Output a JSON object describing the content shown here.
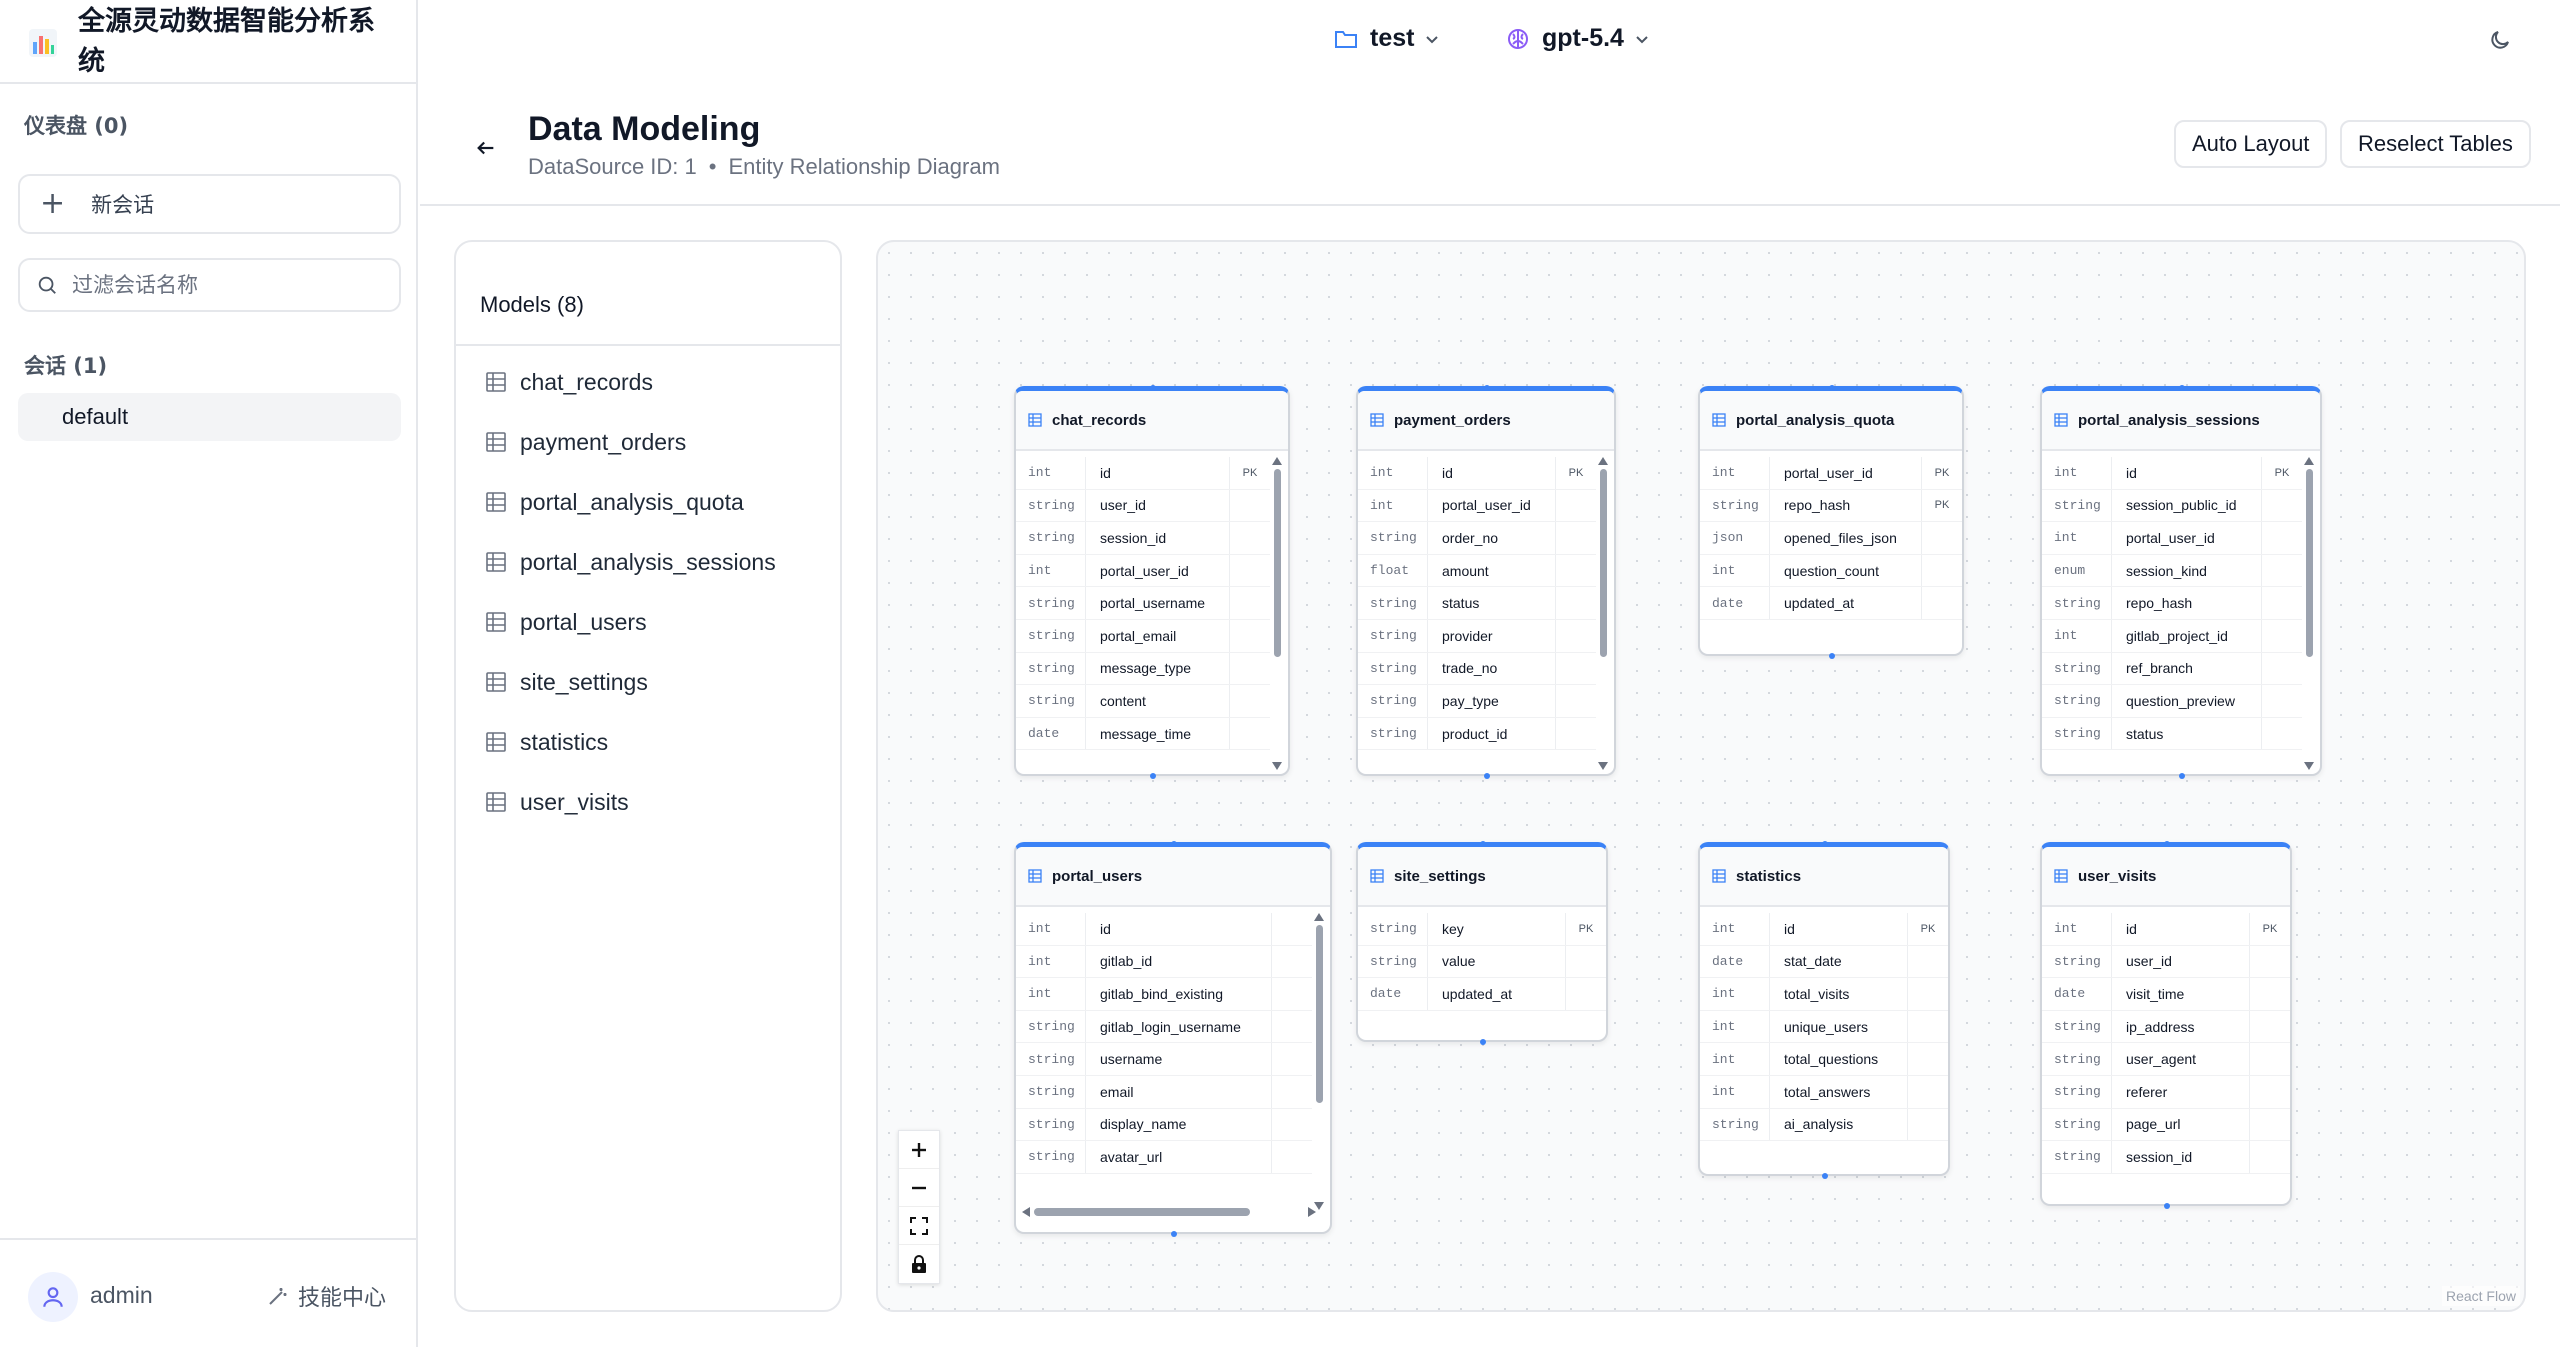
{
  "sidebar": {
    "brand": {
      "title": "全源灵动数据智能分析系统",
      "logo_icon": "bar-chart-icon"
    },
    "dashboards_heading": "仪表盘 (0)",
    "new_chat_label": "新会话",
    "filter_placeholder": "过滤会话名称",
    "conversations_heading": "会话 (1)",
    "conversations": [
      {
        "label": "default",
        "selected": true
      }
    ],
    "user": {
      "name": "admin"
    },
    "skills_label": "技能中心"
  },
  "topbar": {
    "project": {
      "label": "test",
      "icon": "folder-icon"
    },
    "model": {
      "label": "gpt-5.4",
      "icon": "brain-icon"
    },
    "theme_toggle_icon": "moon-icon"
  },
  "header": {
    "title": "Data Modeling",
    "datasource": "DataSource ID: 1",
    "separator": "•",
    "subtitle": "Entity Relationship Diagram",
    "auto_layout_label": "Auto Layout",
    "reselect_label": "Reselect Tables"
  },
  "models": {
    "title": "Models (8)",
    "items": [
      "chat_records",
      "payment_orders",
      "portal_analysis_quota",
      "portal_analysis_sessions",
      "portal_users",
      "site_settings",
      "statistics",
      "user_visits"
    ]
  },
  "canvas": {
    "attribution": "React Flow",
    "accent_color": "#3b82f6"
  },
  "tables": [
    {
      "name": "chat_records",
      "scroll_v": true,
      "fields": [
        {
          "type": "int",
          "name": "id",
          "pk": "PK"
        },
        {
          "type": "string",
          "name": "user_id",
          "pk": ""
        },
        {
          "type": "string",
          "name": "session_id",
          "pk": ""
        },
        {
          "type": "int",
          "name": "portal_user_id",
          "pk": ""
        },
        {
          "type": "string",
          "name": "portal_username",
          "pk": ""
        },
        {
          "type": "string",
          "name": "portal_email",
          "pk": ""
        },
        {
          "type": "string",
          "name": "message_type",
          "pk": ""
        },
        {
          "type": "string",
          "name": "content",
          "pk": ""
        },
        {
          "type": "date",
          "name": "message_time",
          "pk": ""
        }
      ]
    },
    {
      "name": "payment_orders",
      "scroll_v": true,
      "fields": [
        {
          "type": "int",
          "name": "id",
          "pk": "PK"
        },
        {
          "type": "int",
          "name": "portal_user_id",
          "pk": ""
        },
        {
          "type": "string",
          "name": "order_no",
          "pk": ""
        },
        {
          "type": "float",
          "name": "amount",
          "pk": ""
        },
        {
          "type": "string",
          "name": "status",
          "pk": ""
        },
        {
          "type": "string",
          "name": "provider",
          "pk": ""
        },
        {
          "type": "string",
          "name": "trade_no",
          "pk": ""
        },
        {
          "type": "string",
          "name": "pay_type",
          "pk": ""
        },
        {
          "type": "string",
          "name": "product_id",
          "pk": ""
        }
      ]
    },
    {
      "name": "portal_analysis_quota",
      "scroll_v": false,
      "fields": [
        {
          "type": "int",
          "name": "portal_user_id",
          "pk": "PK"
        },
        {
          "type": "string",
          "name": "repo_hash",
          "pk": "PK"
        },
        {
          "type": "json",
          "name": "opened_files_json",
          "pk": ""
        },
        {
          "type": "int",
          "name": "question_count",
          "pk": ""
        },
        {
          "type": "date",
          "name": "updated_at",
          "pk": ""
        }
      ]
    },
    {
      "name": "portal_analysis_sessions",
      "scroll_v": true,
      "fields": [
        {
          "type": "int",
          "name": "id",
          "pk": "PK"
        },
        {
          "type": "string",
          "name": "session_public_id",
          "pk": ""
        },
        {
          "type": "int",
          "name": "portal_user_id",
          "pk": ""
        },
        {
          "type": "enum",
          "name": "session_kind",
          "pk": ""
        },
        {
          "type": "string",
          "name": "repo_hash",
          "pk": ""
        },
        {
          "type": "int",
          "name": "gitlab_project_id",
          "pk": ""
        },
        {
          "type": "string",
          "name": "ref_branch",
          "pk": ""
        },
        {
          "type": "string",
          "name": "question_preview",
          "pk": ""
        },
        {
          "type": "string",
          "name": "status",
          "pk": ""
        }
      ]
    },
    {
      "name": "portal_users",
      "scroll_v": true,
      "scroll_h": true,
      "fields": [
        {
          "type": "int",
          "name": "id",
          "pk": ""
        },
        {
          "type": "int",
          "name": "gitlab_id",
          "pk": ""
        },
        {
          "type": "int",
          "name": "gitlab_bind_existing",
          "pk": ""
        },
        {
          "type": "string",
          "name": "gitlab_login_username",
          "pk": ""
        },
        {
          "type": "string",
          "name": "username",
          "pk": ""
        },
        {
          "type": "string",
          "name": "email",
          "pk": ""
        },
        {
          "type": "string",
          "name": "display_name",
          "pk": ""
        },
        {
          "type": "string",
          "name": "avatar_url",
          "pk": ""
        }
      ]
    },
    {
      "name": "site_settings",
      "scroll_v": false,
      "fields": [
        {
          "type": "string",
          "name": "key",
          "pk": "PK"
        },
        {
          "type": "string",
          "name": "value",
          "pk": ""
        },
        {
          "type": "date",
          "name": "updated_at",
          "pk": ""
        }
      ]
    },
    {
      "name": "statistics",
      "scroll_v": false,
      "fields": [
        {
          "type": "int",
          "name": "id",
          "pk": "PK"
        },
        {
          "type": "date",
          "name": "stat_date",
          "pk": ""
        },
        {
          "type": "int",
          "name": "total_visits",
          "pk": ""
        },
        {
          "type": "int",
          "name": "unique_users",
          "pk": ""
        },
        {
          "type": "int",
          "name": "total_questions",
          "pk": ""
        },
        {
          "type": "int",
          "name": "total_answers",
          "pk": ""
        },
        {
          "type": "string",
          "name": "ai_analysis",
          "pk": ""
        }
      ]
    },
    {
      "name": "user_visits",
      "scroll_v": false,
      "fields": [
        {
          "type": "int",
          "name": "id",
          "pk": "PK"
        },
        {
          "type": "string",
          "name": "user_id",
          "pk": ""
        },
        {
          "type": "date",
          "name": "visit_time",
          "pk": ""
        },
        {
          "type": "string",
          "name": "ip_address",
          "pk": ""
        },
        {
          "type": "string",
          "name": "user_agent",
          "pk": ""
        },
        {
          "type": "string",
          "name": "referer",
          "pk": ""
        },
        {
          "type": "string",
          "name": "page_url",
          "pk": ""
        },
        {
          "type": "string",
          "name": "session_id",
          "pk": ""
        }
      ]
    }
  ],
  "flow_controls": [
    {
      "icon": "zoom-in-icon"
    },
    {
      "icon": "zoom-out-icon"
    },
    {
      "icon": "fit-view-icon"
    },
    {
      "icon": "lock-icon"
    }
  ]
}
